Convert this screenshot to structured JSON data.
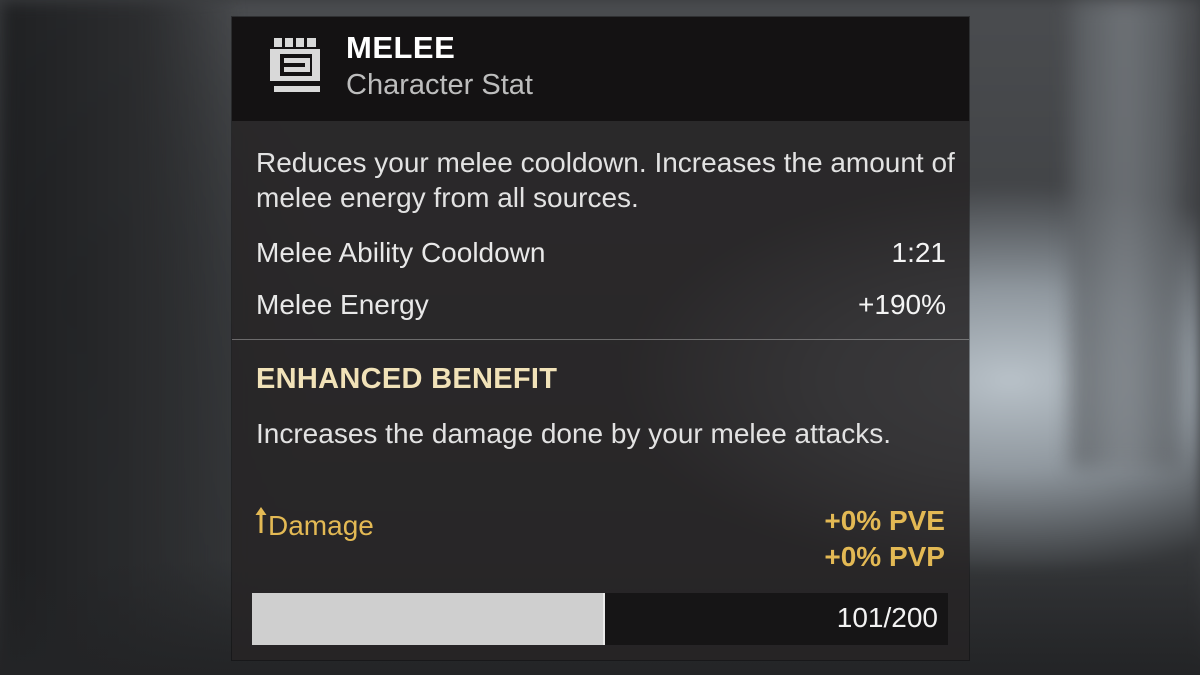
{
  "header": {
    "icon": "melee-fist-icon",
    "title": "MELEE",
    "subtitle": "Character Stat"
  },
  "description": "Reduces your melee cooldown. Increases the amount of melee energy from all sources.",
  "stats": [
    {
      "label": "Melee Ability Cooldown",
      "value": "1:21"
    },
    {
      "label": "Melee Energy",
      "value": "+190%"
    }
  ],
  "enhanced": {
    "title": "ENHANCED BENEFIT",
    "description": "Increases the damage done by your melee attacks.",
    "damage_label": "Damage",
    "arrow_icon": "up-arrow-icon",
    "pve": "+0% PVE",
    "pvp": "+0% PVP"
  },
  "progress": {
    "text": "101/200",
    "current": 101,
    "max": 200
  },
  "colors": {
    "accent_gold": "#e3b954",
    "enhanced_title": "#f1e2b8",
    "bar_fill": "#cfcfcf"
  }
}
